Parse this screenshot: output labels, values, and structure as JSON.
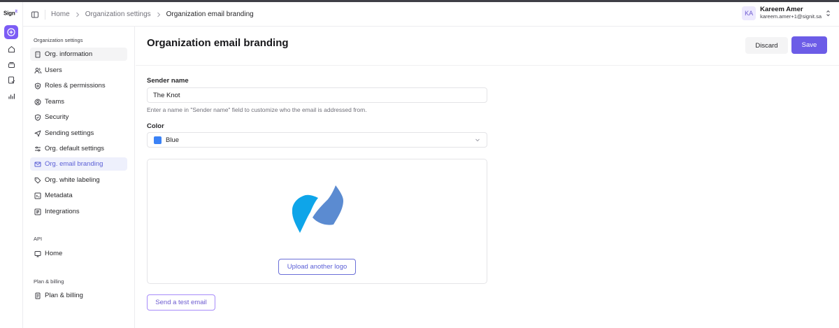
{
  "brand": {
    "name": "Sign",
    "superscript": "it"
  },
  "rail": {
    "items": [
      {
        "icon": "plus-circle-icon",
        "active": true
      },
      {
        "icon": "home-icon",
        "active": false
      },
      {
        "icon": "stack-icon",
        "active": false
      },
      {
        "icon": "document-check-icon",
        "active": false
      },
      {
        "icon": "analytics-icon",
        "active": false
      }
    ]
  },
  "breadcrumb": {
    "home": "Home",
    "settings": "Organization settings",
    "current": "Organization email branding"
  },
  "user": {
    "initials": "KA",
    "name": "Kareem Amer",
    "email": "kareem.amer+1@signit.sa"
  },
  "sidebar": {
    "org_section_title": "Organization settings",
    "org_items": [
      {
        "label": "Org. information",
        "icon": "building-icon"
      },
      {
        "label": "Users",
        "icon": "users-icon"
      },
      {
        "label": "Roles & permissions",
        "icon": "shield-gear-icon"
      },
      {
        "label": "Teams",
        "icon": "team-icon"
      },
      {
        "label": "Security",
        "icon": "shield-icon"
      },
      {
        "label": "Sending settings",
        "icon": "send-icon"
      },
      {
        "label": "Org. default settings",
        "icon": "sliders-icon"
      },
      {
        "label": "Org. email branding",
        "icon": "mail-icon"
      },
      {
        "label": "Org. white labeling",
        "icon": "tag-icon"
      },
      {
        "label": "Metadata",
        "icon": "metadata-icon"
      },
      {
        "label": "Integrations",
        "icon": "integrations-icon"
      }
    ],
    "api_section_title": "API",
    "api_items": [
      {
        "label": "Home",
        "icon": "api-home-icon"
      }
    ],
    "billing_section_title": "Plan & billing",
    "billing_items": [
      {
        "label": "Plan & billing",
        "icon": "receipt-icon"
      }
    ]
  },
  "main": {
    "title": "Organization email branding",
    "discard_label": "Discard",
    "save_label": "Save",
    "sender_name_label": "Sender name",
    "sender_name_value": "The Knot",
    "sender_name_hint": "Enter a name in \"Sender name\" field to customize who the email is addressed from.",
    "color_label": "Color",
    "color_value": "Blue",
    "color_hex": "#3b82f6",
    "upload_label": "Upload another logo",
    "test_email_label": "Send a test email"
  }
}
